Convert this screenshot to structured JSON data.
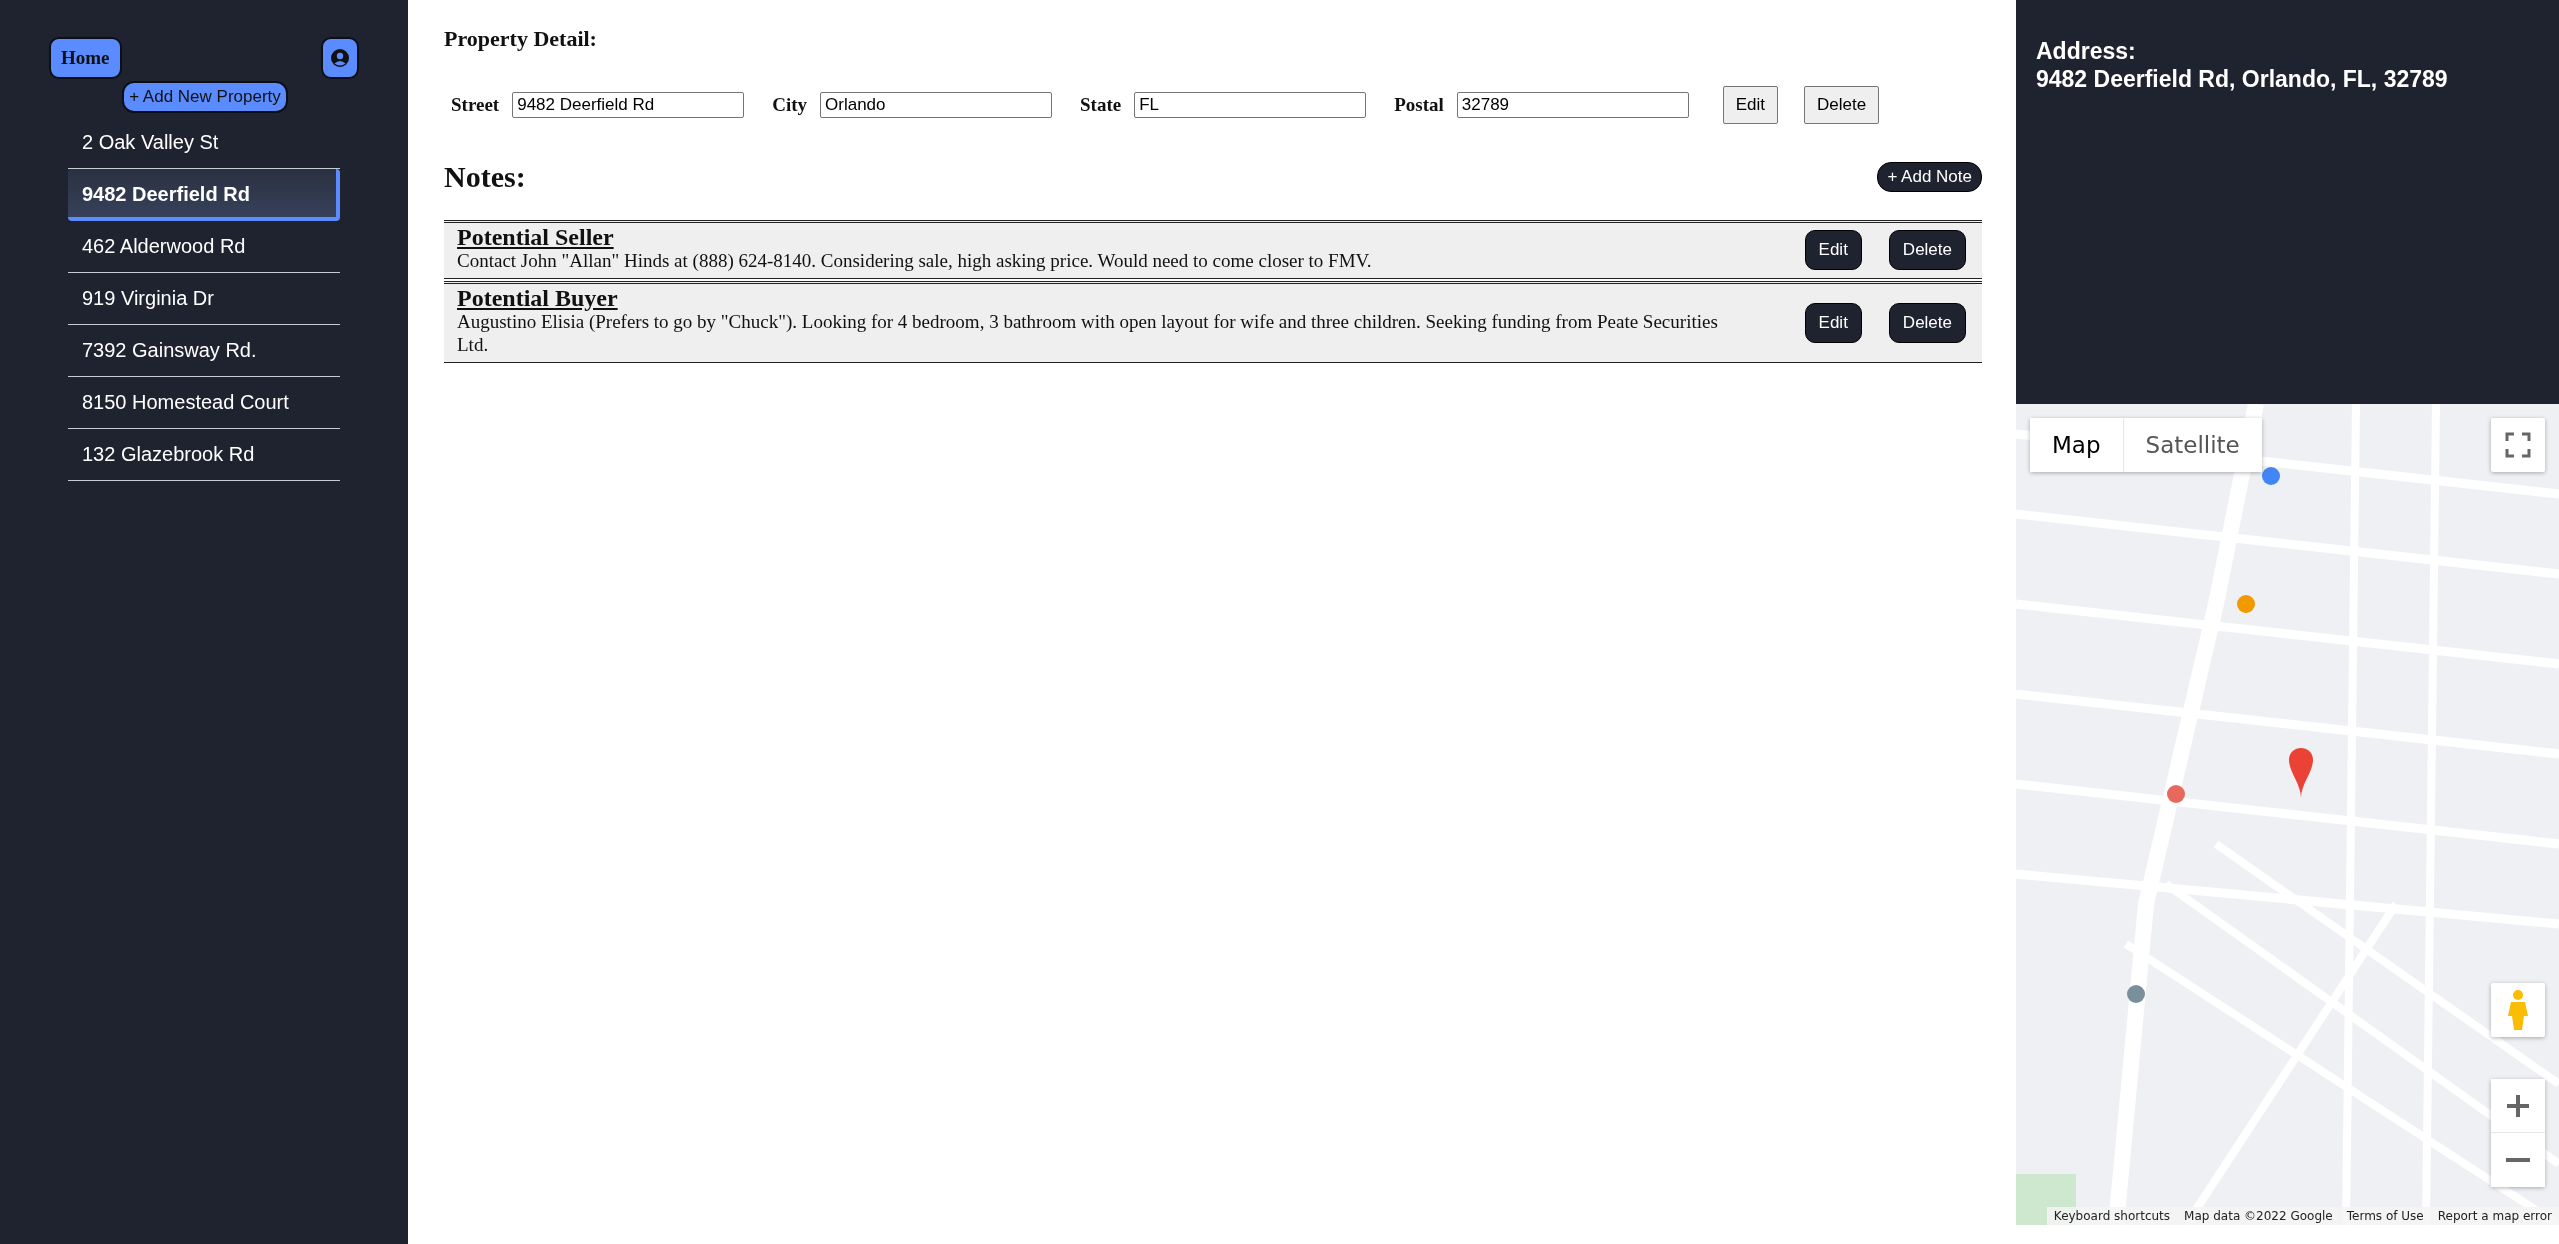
{
  "sidebar": {
    "home_button": "Home",
    "add_button": "+ Add New Property",
    "properties": [
      {
        "label": "2 Oak Valley St",
        "selected": false
      },
      {
        "label": "9482 Deerfield Rd",
        "selected": true
      },
      {
        "label": "462 Alderwood Rd",
        "selected": false
      },
      {
        "label": "919 Virginia Dr",
        "selected": false
      },
      {
        "label": "7392 Gainsway Rd.",
        "selected": false
      },
      {
        "label": "8150 Homestead Court",
        "selected": false
      },
      {
        "label": "132 Glazebrook Rd",
        "selected": false
      }
    ]
  },
  "detail": {
    "title": "Property Detail:",
    "fields": [
      {
        "label": "Street",
        "value": "9482 Deerfield Rd"
      },
      {
        "label": "City",
        "value": "Orlando"
      },
      {
        "label": "State",
        "value": "FL"
      },
      {
        "label": "Postal",
        "value": "32789"
      }
    ],
    "buttons": [
      "Edit",
      "Delete"
    ]
  },
  "notes": {
    "title": "Notes:",
    "add_button": "+ Add Note",
    "items": [
      {
        "title": "Potential Seller",
        "text": "Contact John \"Allan\" Hinds at (888) 624-8140. Considering sale, high asking price. Would need to come closer to FMV.",
        "buttons": [
          "Edit",
          "Delete"
        ]
      },
      {
        "title": "Potential Buyer",
        "text": "Augustino Elisia (Prefers to go by \"Chuck\"). Looking for 4 bedroom, 3 bathroom with open layout for wife and three children. Seeking funding from Peate Securities Ltd.",
        "buttons": [
          "Edit",
          "Delete"
        ]
      }
    ]
  },
  "address": {
    "label": "Address:",
    "value": "9482 Deerfield Rd, Orlando, FL, 32789"
  },
  "map": {
    "types": [
      {
        "label": "Map",
        "selected": true
      },
      {
        "label": "Satellite",
        "selected": false
      }
    ],
    "footer": [
      "Keyboard shortcuts",
      "Map data ©2022 Google",
      "Terms of Use",
      "Report a map error"
    ]
  }
}
